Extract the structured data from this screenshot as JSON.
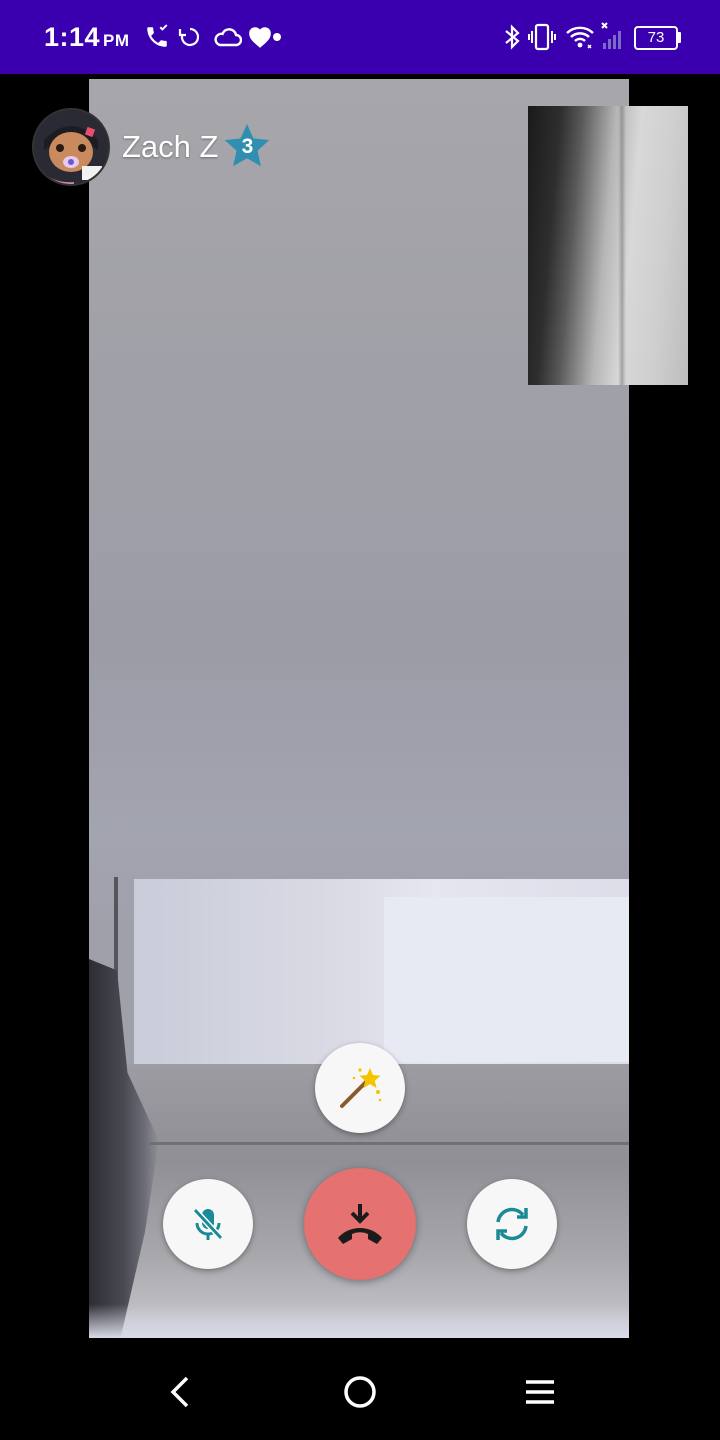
{
  "status_bar": {
    "time": "1:14",
    "ampm": "PM",
    "battery_level": "73",
    "background_color": "#3a00b0",
    "left_icons": [
      "call-icon",
      "sync-icon",
      "cloud-icon",
      "heart-icon",
      "dot-icon"
    ],
    "right_icons": [
      "bluetooth-icon",
      "vibrate-icon",
      "wifi-icon",
      "signal-icon",
      "battery-icon"
    ]
  },
  "call": {
    "caller_name": "Zach Z",
    "badge_level": "3",
    "badge_color": "#2f8fb0"
  },
  "controls": {
    "effects_icon": "magic-wand-icon",
    "mute_icon": "mic-off-icon",
    "hangup_icon": "end-call-icon",
    "flip_icon": "switch-camera-icon",
    "accent_color": "#1a8a96",
    "hangup_color": "#e57171"
  },
  "nav_bar": {
    "buttons": [
      "back-icon",
      "home-icon",
      "menu-icon"
    ]
  }
}
